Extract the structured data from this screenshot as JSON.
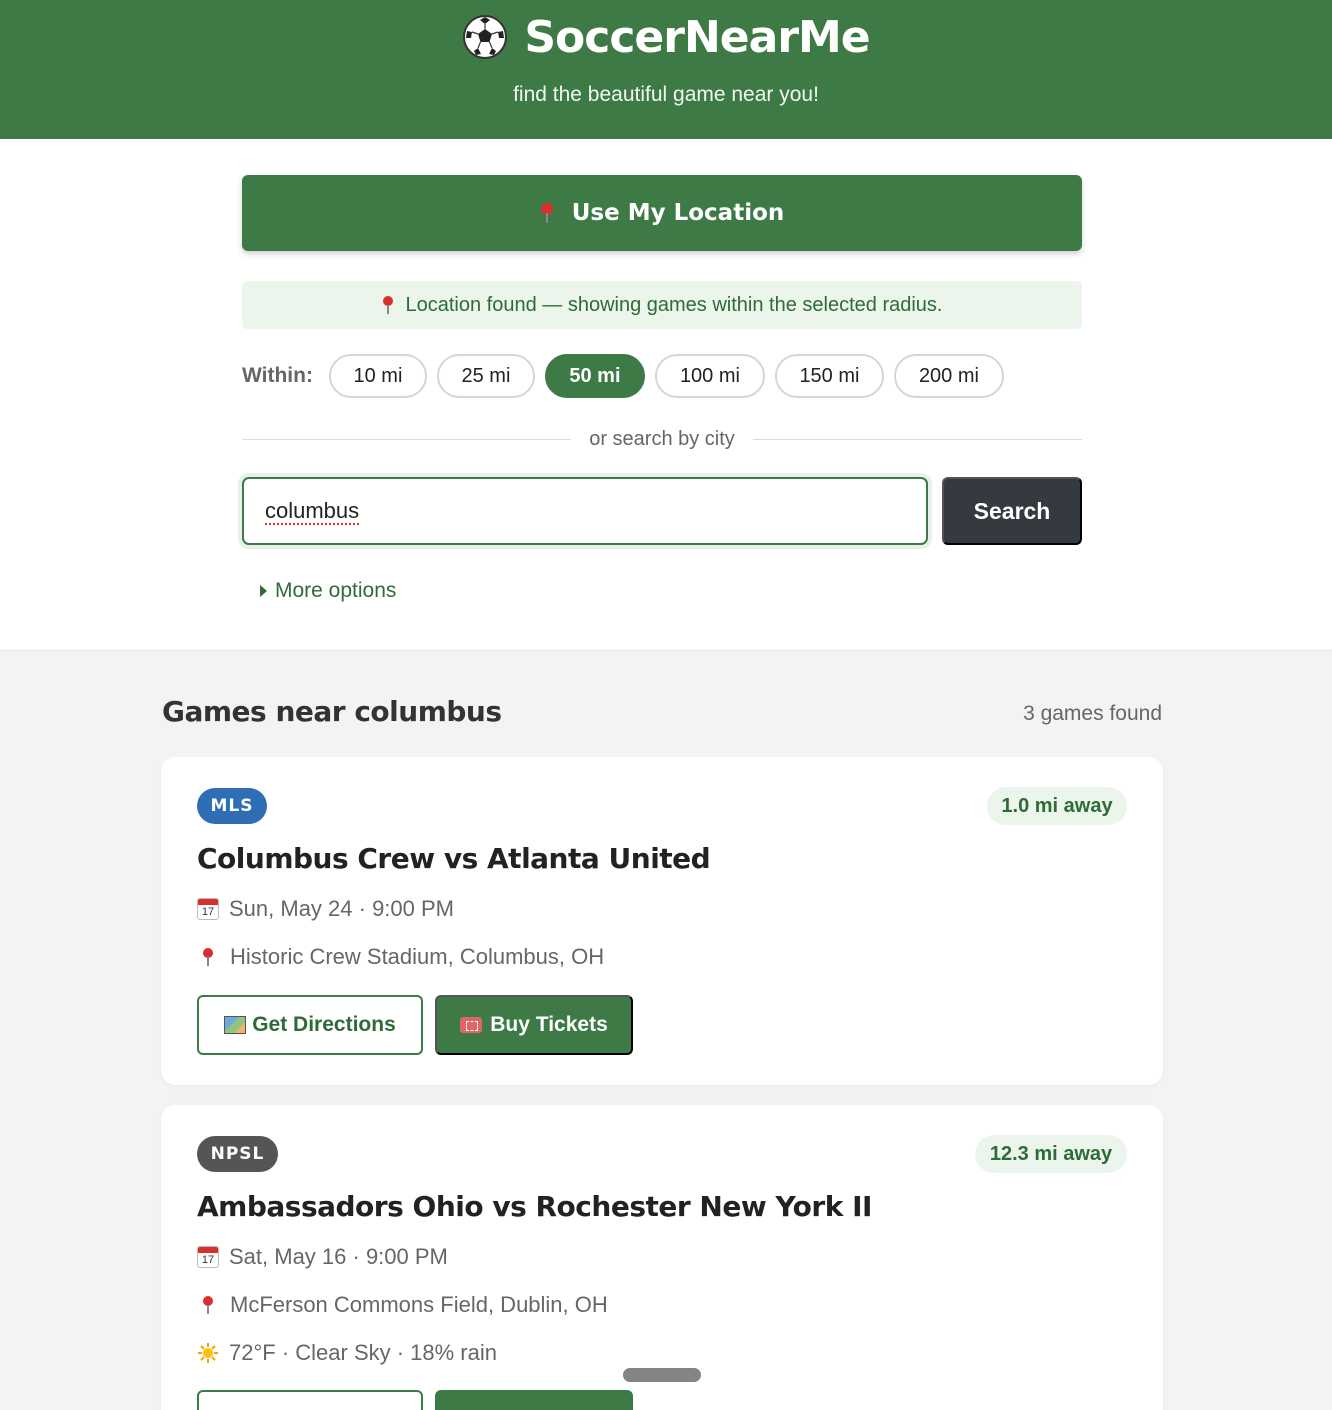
{
  "header": {
    "title": "SoccerNearMe",
    "tagline": "find the beautiful game near you!"
  },
  "location": {
    "button_label": "Use My Location",
    "status": "Location found — showing games within the selected radius."
  },
  "radius": {
    "label": "Within:",
    "options": [
      "10 mi",
      "25 mi",
      "50 mi",
      "100 mi",
      "150 mi",
      "200 mi"
    ],
    "selected": "50 mi"
  },
  "city_search": {
    "divider": "or search by city",
    "value": "columbus",
    "button_label": "Search",
    "more_options": "More options"
  },
  "results": {
    "title": "Games near columbus",
    "count": "3 games found",
    "games": [
      {
        "league": "MLS",
        "league_color": "#2f6db5",
        "distance": "1.0 mi away",
        "title": "Columbus Crew vs Atlanta United",
        "datetime": "Sun, May 24 · 9:00 PM",
        "venue": "Historic Crew Stadium, Columbus, OH",
        "calendar_day": "17",
        "directions_label": "Get Directions",
        "tickets_label": "Buy Tickets"
      },
      {
        "league": "NPSL",
        "league_color": "#555555",
        "distance": "12.3 mi away",
        "title": "Ambassadors Ohio vs Rochester New York II",
        "datetime": "Sat, May 16 · 9:00 PM",
        "venue": "McFerson Commons Field, Dublin, OH",
        "weather": "72°F · Clear Sky · 18% rain",
        "calendar_day": "17"
      }
    ]
  },
  "colors": {
    "primary_green": "#3d7a46",
    "light_green": "#ebf5ec",
    "dark_button": "#343a40"
  }
}
